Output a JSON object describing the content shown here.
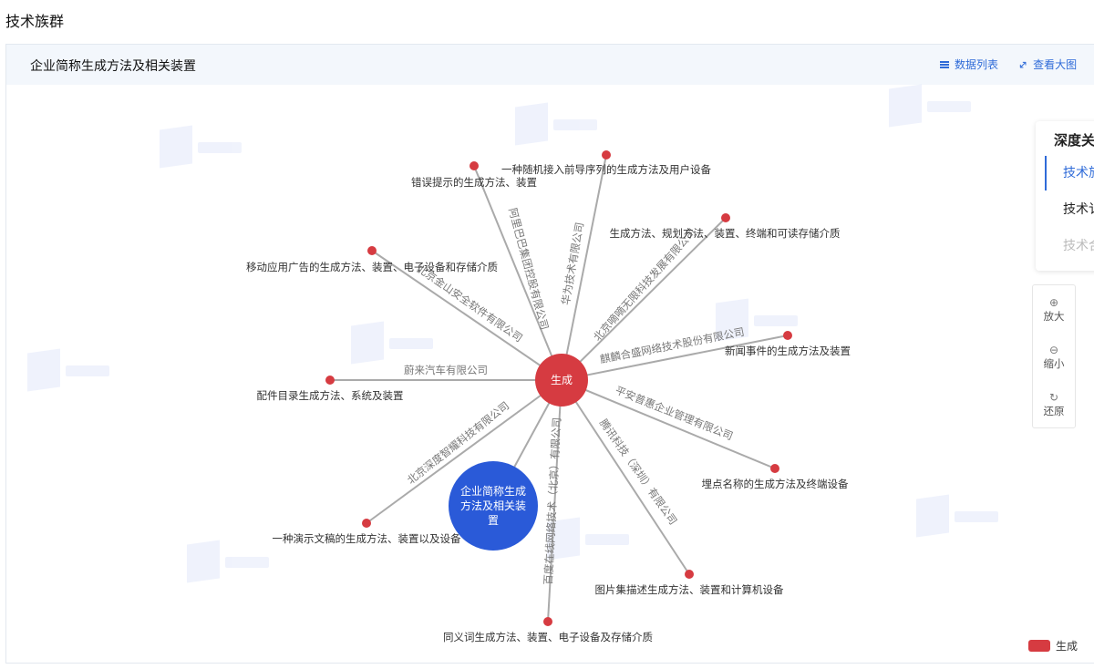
{
  "page": {
    "title": "技术族群"
  },
  "panel": {
    "title": "企业简称生成方法及相关装置",
    "data_list_label": "数据列表",
    "view_large_label": "查看大图"
  },
  "graph": {
    "center": {
      "label": "生成",
      "color": "#d63b41"
    },
    "topic": {
      "label_lines": [
        "企业简称生成",
        "方法及相关装",
        "置"
      ],
      "color": "#2a5ad8"
    },
    "branches": [
      {
        "company": "阿里巴巴集团控股有限公司",
        "patent": "错误提示的生成方法、装置"
      },
      {
        "company": "华为技术有限公司",
        "patent": "一种随机接入前导序列的生成方法及用户设备"
      },
      {
        "company": "北京嘀嘀无限科技发展有限公司",
        "patent": "生成方法、规划方法、装置、终端和可读存储介质"
      },
      {
        "company": "北京金山安全软件有限公司",
        "patent": "移动应用广告的生成方法、装置、电子设备和存储介质"
      },
      {
        "company": "麒麟合盛网络技术股份有限公司",
        "patent": "新闻事件的生成方法及装置"
      },
      {
        "company": "蔚来汽车有限公司",
        "patent": "配件目录生成方法、系统及装置"
      },
      {
        "company": "平安普惠企业管理有限公司",
        "patent": "埋点名称的生成方法及终端设备"
      },
      {
        "company": "北京深度智耀科技有限公司",
        "patent": "一种演示文稿的生成方法、装置以及设备"
      },
      {
        "company": "腾讯科技（深圳）有限公司",
        "patent": "图片集描述生成方法、装置和计算机设备"
      },
      {
        "company": "百度在线网络技术（北京）有限公司",
        "patent": "同义词生成方法、装置、电子设备及存储介质"
      }
    ],
    "edge_color": "#aaaaaa"
  },
  "depth_panel": {
    "title": "深度关",
    "items": [
      "技术旅",
      "技术讠",
      "技术合"
    ]
  },
  "zoom": {
    "zoom_in_label": "放大",
    "zoom_out_label": "缩小",
    "reset_label": "还原"
  },
  "legend": {
    "label": "生成",
    "color": "#d63b41"
  }
}
